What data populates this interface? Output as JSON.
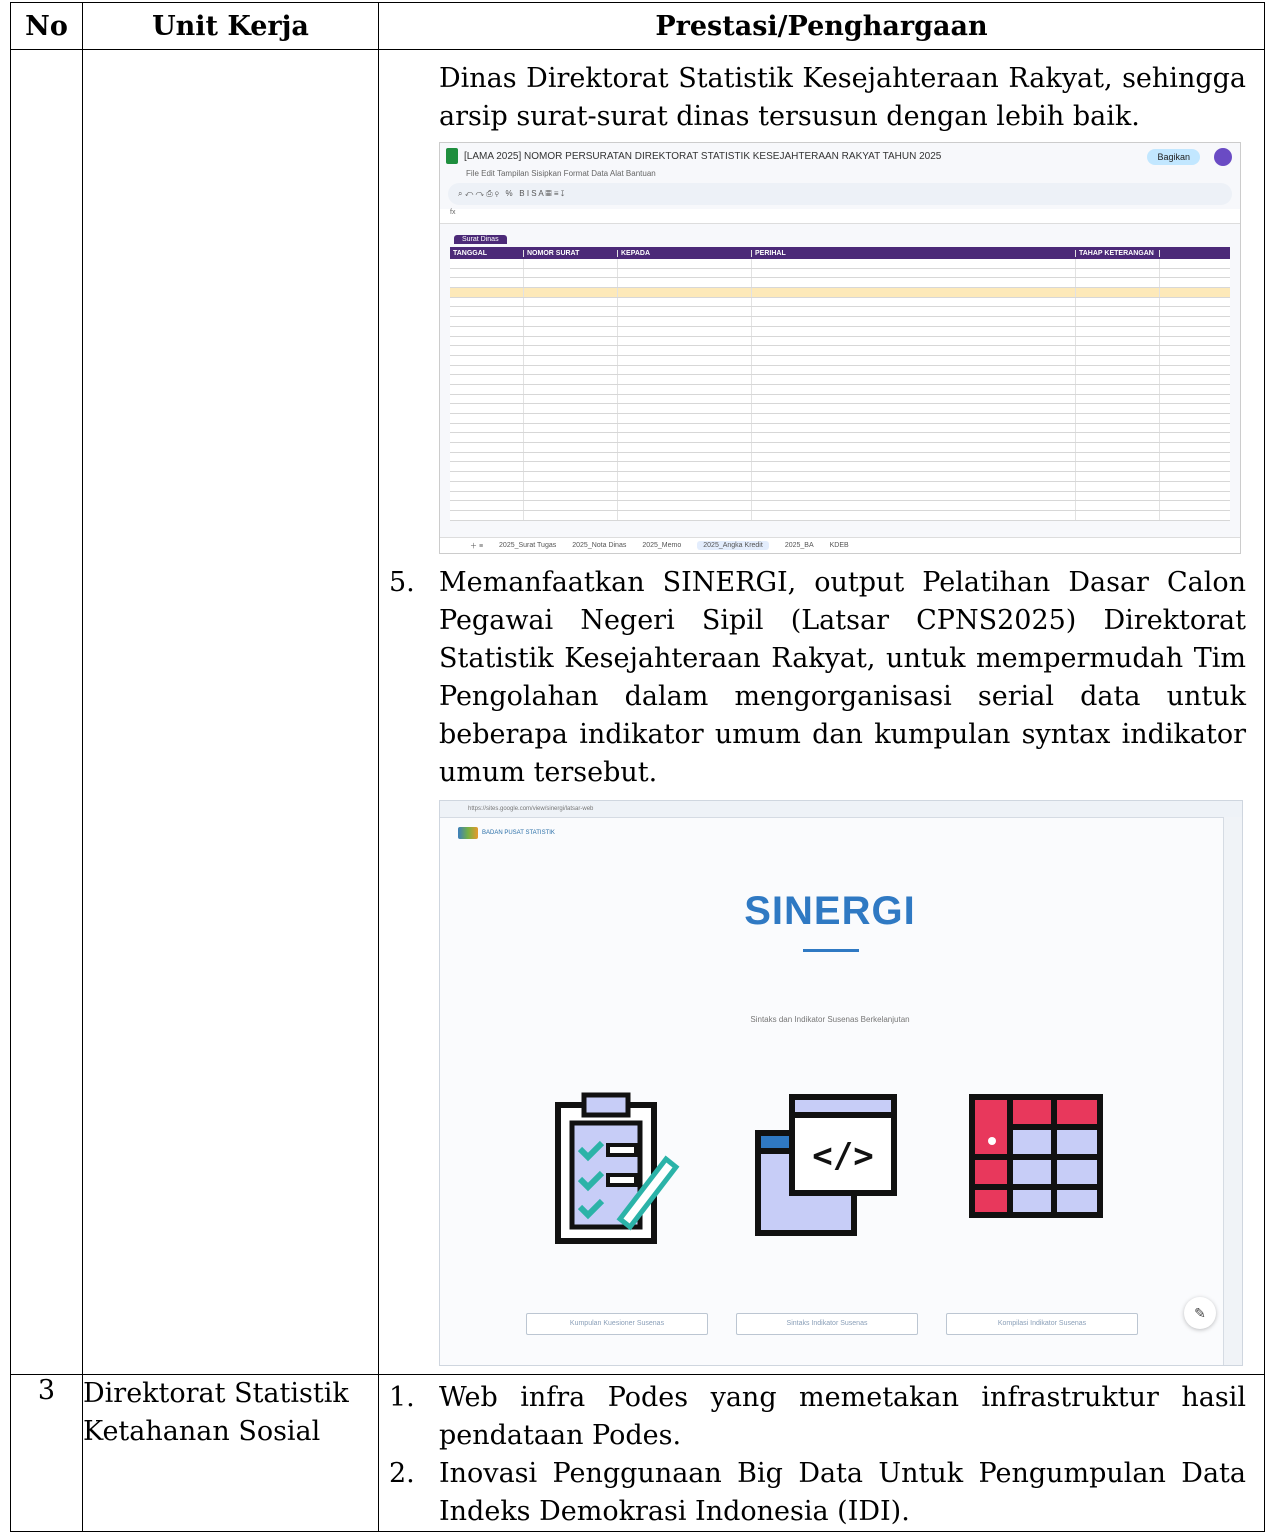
{
  "table": {
    "headers": {
      "no": "No",
      "unit": "Unit Kerja",
      "prestasi": "Prestasi/Penghargaan"
    },
    "continuation_text": "Dinas Direktorat Statistik Kesejahteraan Rakyat, sehingga arsip surat-surat dinas tersusun dengan lebih baik.",
    "item5": {
      "num": "5.",
      "text": "Memanfaatkan SINERGI, output  Pelatihan Dasar Calon Pegawai Negeri Sipil (Latsar CPNS2025) Direktorat Statistik Kesejahteraan Rakyat, untuk mempermudah Tim Pengolahan dalam mengorganisasi serial data untuk beberapa indikator umum dan kumpulan syntax indikator umum tersebut."
    },
    "row3": {
      "no": "3",
      "unit": "Direktorat Statistik Ketahanan Sosial",
      "items": [
        {
          "num": "1.",
          "text": "Web infra Podes yang memetakan infrastruktur hasil pendataan Podes."
        },
        {
          "num": "2.",
          "text": "Inovasi Penggunaan Big Data Untuk Pengumpulan Data Indeks Demokrasi Indonesia (IDI)."
        }
      ]
    }
  },
  "spreadsheet": {
    "doc_title": "[LAMA 2025] NOMOR PERSURATAN DIREKTORAT STATISTIK KESEJAHTERAAN RAKYAT TAHUN 2025",
    "menus": "File  Edit  Tampilan  Sisipkan  Format  Data  Alat  Bantuan",
    "share_label": "Bagikan",
    "filter_tab": "Surat Dinas",
    "columns": [
      "TANGGAL",
      "NOMOR SURAT",
      "KEPADA",
      "PERIHAL",
      "TAHAP KETERANGAN"
    ],
    "highlight_row": 3,
    "row_count": 27,
    "tabs": [
      "2025_Surat Tugas",
      "2025_Nota Dinas",
      "2025_Memo",
      "2025_Angka Kredit",
      "2025_BA",
      "KDEB"
    ],
    "active_tab": "2025_Angka Kredit"
  },
  "browser": {
    "url": "https://sites.google.com/view/sinergi/latsar-web",
    "logo_text": "BADAN PUSAT STATISTIK",
    "title": "SINERGI",
    "subtitle": "Sintaks dan Indikator Susenas Berkelanjutan",
    "buttons": [
      "Kumpulan Kuesioner Susenas",
      "Sintaks Indikator Susenas",
      "Kompilasi Indikator Susenas"
    ],
    "colors": {
      "accent": "#2f79c3",
      "icon_fill": "#c7cdf7",
      "icon_red": "#e8385c",
      "check": "#2bb3a8"
    }
  }
}
